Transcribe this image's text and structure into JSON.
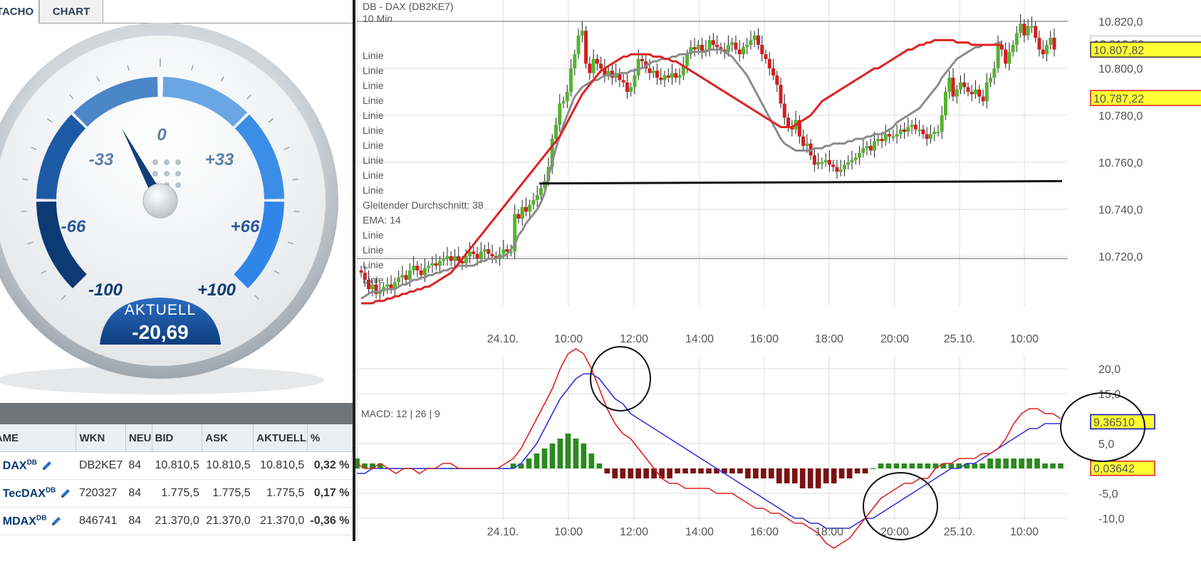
{
  "tabs": {
    "tacho": "TACHO",
    "chart": "CHART"
  },
  "gauge": {
    "scale_labels": [
      "-100",
      "-66",
      "-33",
      "0",
      "+33",
      "+66",
      "+100"
    ],
    "current_label": "AKTUELL",
    "current_value": "-20,69",
    "needle_value": -20.69
  },
  "table": {
    "headers": [
      "NAME",
      "WKN",
      "NEU",
      "BID",
      "ASK",
      "AKTUELL",
      "%"
    ],
    "rows": [
      {
        "name": "DAX",
        "sup": "DB",
        "wkn": "DB2KE7",
        "ne": "84",
        "bid": "10.810,5",
        "ask": "10.810,5",
        "aktuell": "10.810,5",
        "pct": "0,32 %",
        "trend": "pos"
      },
      {
        "name": "TecDAX",
        "sup": "DB",
        "wkn": "720327",
        "ne": "84",
        "bid": "1.775,5",
        "ask": "1.775,5",
        "aktuell": "1.775,5",
        "pct": "0,17 %",
        "trend": "pos"
      },
      {
        "name": "MDAX",
        "sup": "DB",
        "wkn": "846741",
        "ne": "84",
        "bid": "21.370,0",
        "ask": "21.370,0",
        "aktuell": "21.370,0",
        "pct": "-0,36 %",
        "trend": "neg"
      }
    ]
  },
  "chart_data": [
    {
      "type": "candlestick",
      "title": "DB - DAX (DB2KE7)",
      "subtitle": "10 Min",
      "x_labels": [
        "24.10.",
        "10:00",
        "12:00",
        "14:00",
        "16:00",
        "18:00",
        "20:00",
        "25.10.",
        "10:00"
      ],
      "y_ticks": [
        "10.720,0",
        "10.740,0",
        "10.760,0",
        "10.780,0",
        "10.800,0",
        "10.820,0"
      ],
      "ylim": [
        10700,
        10830
      ],
      "legend": [
        "Linie",
        "Linie",
        "Linie",
        "Linie",
        "Linie",
        "Linie",
        "Linie",
        "Linie",
        "Linie",
        "Linie",
        "Gleitender Durchschnitt: 38",
        "EMA: 14",
        "Linie",
        "Linie",
        "Linie",
        "Linie"
      ],
      "price_tags": {
        "last": "10.807,82",
        "ma": "10.787,22",
        "hidden": "10.810,50"
      },
      "horizontal_lines": [
        10820,
        10719
      ],
      "trend_line": [
        10751,
        10752
      ],
      "close": [
        10713,
        10710,
        10706,
        10708,
        10704,
        10705,
        10707,
        10708,
        10706,
        10709,
        10711,
        10712,
        10710,
        10714,
        10716,
        10714,
        10712,
        10715,
        10716,
        10717,
        10716,
        10718,
        10719,
        10720,
        10718,
        10720,
        10718,
        10717,
        10720,
        10722,
        10721,
        10719,
        10722,
        10723,
        10721,
        10720,
        10719,
        10721,
        10723,
        10722,
        10722,
        10738,
        10736,
        10741,
        10739,
        10742,
        10744,
        10746,
        10749,
        10752,
        10758,
        10770,
        10776,
        10785,
        10786,
        10790,
        10800,
        10806,
        10814,
        10816,
        10802,
        10798,
        10804,
        10802,
        10800,
        10797,
        10799,
        10796,
        10798,
        10795,
        10794,
        10790,
        10792,
        10797,
        10804,
        10803,
        10800,
        10798,
        10799,
        10796,
        10795,
        10797,
        10796,
        10798,
        10796,
        10797,
        10801,
        10806,
        10809,
        10808,
        10810,
        10807,
        10808,
        10812,
        10810,
        10809,
        10808,
        10807,
        10810,
        10811,
        10808,
        10806,
        10809,
        10810,
        10812,
        10814,
        10810,
        10806,
        10804,
        10800,
        10797,
        10793,
        10785,
        10779,
        10775,
        10774,
        10778,
        10771,
        10767,
        10768,
        10763,
        10759,
        10760,
        10760,
        10761,
        10759,
        10758,
        10756,
        10757,
        10759,
        10760,
        10761,
        10762,
        10764,
        10766,
        10767,
        10765,
        10769,
        10770,
        10769,
        10772,
        10771,
        10771,
        10772,
        10774,
        10773,
        10775,
        10776,
        10774,
        10774,
        10772,
        10770,
        10772,
        10773,
        10773,
        10780,
        10790,
        10796,
        10788,
        10791,
        10794,
        10792,
        10790,
        10789,
        10791,
        10788,
        10786,
        10794,
        10796,
        10800,
        10810,
        10808,
        10802,
        10807,
        10810,
        10815,
        10819,
        10814,
        10818,
        10818,
        10813,
        10808,
        10806,
        10810,
        10813,
        10808
      ],
      "ema14": [
        10702,
        10703,
        10704,
        10705,
        10705,
        10705,
        10706,
        10706,
        10706,
        10706,
        10707,
        10708,
        10708,
        10709,
        10710,
        10710,
        10711,
        10711,
        10712,
        10712,
        10713,
        10713,
        10714,
        10714,
        10715,
        10715,
        10716,
        10716,
        10716,
        10716,
        10716,
        10717,
        10718,
        10718,
        10719,
        10719,
        10719,
        10720,
        10720,
        10721,
        10723,
        10725,
        10729,
        10731,
        10734,
        10736,
        10738,
        10740,
        10743,
        10747,
        10754,
        10760,
        10766,
        10771,
        10776,
        10780,
        10784,
        10788,
        10790,
        10792,
        10793,
        10794,
        10795,
        10795,
        10796,
        10797,
        10797,
        10797,
        10797,
        10798,
        10798,
        10798,
        10799,
        10799,
        10800,
        10800,
        10801,
        10802,
        10803,
        10803,
        10804,
        10804,
        10804,
        10805,
        10805,
        10806,
        10806,
        10806,
        10807,
        10807,
        10807,
        10807,
        10807,
        10808,
        10808,
        10808,
        10808,
        10807,
        10806,
        10805,
        10803,
        10801,
        10799,
        10797,
        10794,
        10791,
        10788,
        10785,
        10782,
        10779,
        10776,
        10773,
        10770,
        10768,
        10767,
        10766,
        10765,
        10765,
        10765,
        10765,
        10765,
        10766,
        10766,
        10766,
        10767,
        10767,
        10768,
        10768,
        10768,
        10768,
        10769,
        10769,
        10770,
        10770,
        10770,
        10771,
        10771,
        10772,
        10772,
        10772,
        10773,
        10774,
        10775,
        10777,
        10778,
        10779,
        10780,
        10781,
        10782,
        10783,
        10785,
        10787,
        10789,
        10791,
        10793,
        10796,
        10798,
        10800,
        10802,
        10804,
        10805,
        10806,
        10807,
        10808,
        10809,
        10809,
        10810,
        10810,
        10810,
        10810,
        10811,
        10811
      ],
      "sma38": [
        10700,
        10700,
        10700,
        10700,
        10701,
        10701,
        10701,
        10702,
        10702,
        10703,
        10703,
        10704,
        10704,
        10705,
        10705,
        10706,
        10706,
        10707,
        10707,
        10708,
        10709,
        10710,
        10711,
        10712,
        10713,
        10715,
        10717,
        10719,
        10721,
        10723,
        10725,
        10727,
        10729,
        10731,
        10733,
        10735,
        10737,
        10739,
        10741,
        10743,
        10745,
        10747,
        10749,
        10751,
        10753,
        10755,
        10757,
        10759,
        10761,
        10763,
        10765,
        10767,
        10769,
        10771,
        10774,
        10777,
        10780,
        10783,
        10786,
        10789,
        10791,
        10793,
        10795,
        10797,
        10799,
        10800,
        10801,
        10802,
        10803,
        10804,
        10805,
        10805,
        10806,
        10806,
        10806,
        10806,
        10806,
        10806,
        10805,
        10805,
        10805,
        10804,
        10804,
        10803,
        10803,
        10802,
        10801,
        10800,
        10799,
        10798,
        10797,
        10796,
        10795,
        10794,
        10793,
        10792,
        10791,
        10790,
        10789,
        10788,
        10787,
        10786,
        10785,
        10784,
        10783,
        10782,
        10781,
        10780,
        10779,
        10778,
        10777,
        10776,
        10775,
        10775,
        10775,
        10775,
        10776,
        10777,
        10778,
        10779,
        10780,
        10782,
        10784,
        10786,
        10787,
        10788,
        10789,
        10790,
        10791,
        10792,
        10793,
        10794,
        10795,
        10796,
        10797,
        10798,
        10799,
        10800,
        10800,
        10801,
        10802,
        10803,
        10804,
        10805,
        10806,
        10807,
        10808,
        10808,
        10809,
        10810,
        10810,
        10811,
        10811,
        10812,
        10812,
        10812,
        10812,
        10812,
        10812,
        10811,
        10811,
        10811,
        10811,
        10810,
        10810,
        10810,
        10810,
        10810,
        10810,
        10810,
        10810,
        10810
      ]
    },
    {
      "type": "line",
      "title": "MACD: 12 | 26 | 9",
      "x_labels": [
        "24.10.",
        "10:00",
        "12:00",
        "14:00",
        "16:00",
        "18:00",
        "20:00",
        "25.10.",
        "10:00"
      ],
      "y_ticks": [
        "-10,0",
        "-5,0",
        "5,0",
        "15,0",
        "20,0"
      ],
      "ylim": [
        -15,
        25
      ],
      "value_tags": {
        "macd": "9,36510",
        "histogram": "0,03642"
      },
      "series": [
        {
          "color": "#e02020",
          "values": [
            1,
            0,
            0,
            1,
            0,
            -1,
            0,
            0,
            -1,
            0,
            0,
            1,
            1,
            0,
            0,
            0,
            0,
            0,
            0,
            1,
            2,
            4,
            7,
            10,
            13,
            16,
            20,
            23,
            24,
            23,
            20,
            16,
            12,
            9,
            7,
            6,
            4,
            2,
            0,
            -2,
            -3,
            -3,
            -4,
            -4,
            -4,
            -4,
            -5,
            -5,
            -5,
            -6,
            -7,
            -8,
            -8,
            -9,
            -9,
            -10,
            -11,
            -11,
            -12,
            -13,
            -15,
            -16,
            -15,
            -14,
            -12,
            -10,
            -8,
            -6,
            -5,
            -4,
            -3,
            -3,
            -2,
            -2,
            0,
            1,
            1,
            2,
            2,
            2,
            3,
            3,
            4,
            6,
            9,
            11,
            12,
            12,
            11,
            11,
            10
          ]
        },
        {
          "color": "#3030e0",
          "values": [
            -1,
            -1,
            0,
            0,
            0,
            0,
            0,
            0,
            0,
            0,
            0,
            0,
            0,
            0,
            0,
            0,
            0,
            0,
            0,
            0,
            0,
            1,
            3,
            5,
            8,
            11,
            14,
            16,
            18,
            19,
            19,
            18,
            16,
            14,
            13,
            11,
            10,
            9,
            8,
            7,
            6,
            5,
            4,
            3,
            2,
            1,
            0,
            -1,
            -2,
            -3,
            -4,
            -5,
            -6,
            -7,
            -8,
            -9,
            -10,
            -10,
            -11,
            -11,
            -12,
            -12,
            -12,
            -12,
            -11,
            -10,
            -10,
            -9,
            -8,
            -7,
            -6,
            -5,
            -4,
            -3,
            -2,
            -1,
            0,
            0,
            1,
            1,
            2,
            3,
            4,
            5,
            6,
            7,
            8,
            8,
            9,
            9,
            9
          ]
        },
        {
          "color": "#2a8a1e",
          "type": "histogram",
          "values": [
            2,
            1,
            1,
            1,
            0,
            0,
            0,
            0,
            0,
            0,
            0,
            0,
            0,
            0,
            0,
            0,
            0,
            0,
            0,
            0,
            1,
            1,
            2,
            3,
            4,
            5,
            6,
            7,
            6,
            5,
            3,
            1,
            -1,
            -2,
            -2,
            -2,
            -2,
            -2,
            -2,
            -2,
            -2,
            -1,
            -1,
            -1,
            -1,
            -1,
            -1,
            -1,
            -1,
            -1,
            -2,
            -2,
            -2,
            -2,
            -3,
            -3,
            -3,
            -4,
            -4,
            -4,
            -3,
            -3,
            -2,
            -2,
            -1,
            -1,
            0,
            1,
            1,
            1,
            1,
            1,
            1,
            1,
            1,
            1,
            1,
            1,
            1,
            1,
            1,
            2,
            2,
            2,
            2,
            2,
            2,
            2,
            1,
            1,
            1
          ]
        }
      ]
    }
  ]
}
